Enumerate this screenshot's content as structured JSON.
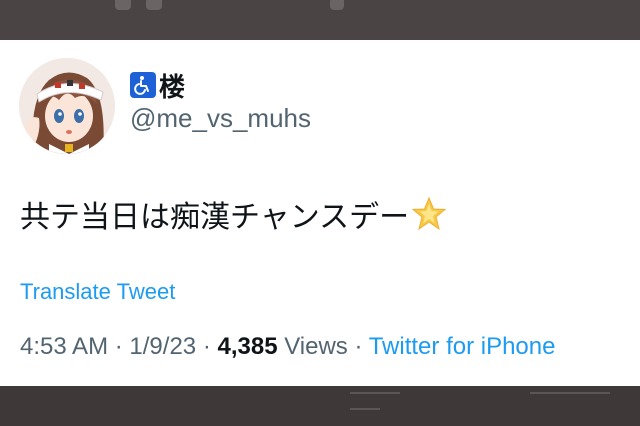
{
  "tweet": {
    "display_name": "楼",
    "handle": "@me_vs_muhs",
    "text": "共テ当日は痴漢チャンスデー",
    "translate_label": "Translate Tweet",
    "time": "4:53 AM",
    "separator": "·",
    "date": "1/9/23",
    "views_count": "4,385",
    "views_label": "Views",
    "source": "Twitter for iPhone"
  },
  "icons": {
    "name_badge": "wheelchair-accessibility-icon",
    "emoji": "glowing-star-emoji"
  },
  "colors": {
    "link_blue": "#1d9bf0",
    "text_primary": "#0f1419",
    "text_secondary": "#536471",
    "badge_blue": "#1d61d6"
  }
}
